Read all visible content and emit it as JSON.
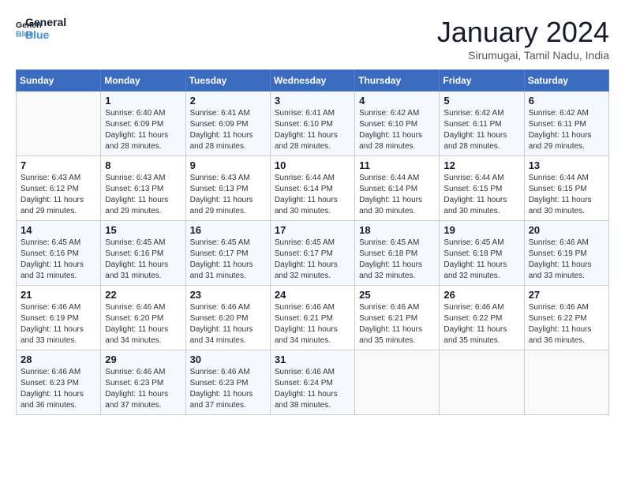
{
  "logo": {
    "text_general": "General",
    "text_blue": "Blue"
  },
  "title": "January 2024",
  "subtitle": "Sirumugai, Tamil Nadu, India",
  "header": {
    "days": [
      "Sunday",
      "Monday",
      "Tuesday",
      "Wednesday",
      "Thursday",
      "Friday",
      "Saturday"
    ]
  },
  "weeks": [
    {
      "cells": [
        {
          "day": "",
          "sunrise": "",
          "sunset": "",
          "daylight": ""
        },
        {
          "day": "1",
          "sunrise": "Sunrise: 6:40 AM",
          "sunset": "Sunset: 6:09 PM",
          "daylight": "Daylight: 11 hours and 28 minutes."
        },
        {
          "day": "2",
          "sunrise": "Sunrise: 6:41 AM",
          "sunset": "Sunset: 6:09 PM",
          "daylight": "Daylight: 11 hours and 28 minutes."
        },
        {
          "day": "3",
          "sunrise": "Sunrise: 6:41 AM",
          "sunset": "Sunset: 6:10 PM",
          "daylight": "Daylight: 11 hours and 28 minutes."
        },
        {
          "day": "4",
          "sunrise": "Sunrise: 6:42 AM",
          "sunset": "Sunset: 6:10 PM",
          "daylight": "Daylight: 11 hours and 28 minutes."
        },
        {
          "day": "5",
          "sunrise": "Sunrise: 6:42 AM",
          "sunset": "Sunset: 6:11 PM",
          "daylight": "Daylight: 11 hours and 28 minutes."
        },
        {
          "day": "6",
          "sunrise": "Sunrise: 6:42 AM",
          "sunset": "Sunset: 6:11 PM",
          "daylight": "Daylight: 11 hours and 29 minutes."
        }
      ]
    },
    {
      "cells": [
        {
          "day": "7",
          "sunrise": "Sunrise: 6:43 AM",
          "sunset": "Sunset: 6:12 PM",
          "daylight": "Daylight: 11 hours and 29 minutes."
        },
        {
          "day": "8",
          "sunrise": "Sunrise: 6:43 AM",
          "sunset": "Sunset: 6:13 PM",
          "daylight": "Daylight: 11 hours and 29 minutes."
        },
        {
          "day": "9",
          "sunrise": "Sunrise: 6:43 AM",
          "sunset": "Sunset: 6:13 PM",
          "daylight": "Daylight: 11 hours and 29 minutes."
        },
        {
          "day": "10",
          "sunrise": "Sunrise: 6:44 AM",
          "sunset": "Sunset: 6:14 PM",
          "daylight": "Daylight: 11 hours and 30 minutes."
        },
        {
          "day": "11",
          "sunrise": "Sunrise: 6:44 AM",
          "sunset": "Sunset: 6:14 PM",
          "daylight": "Daylight: 11 hours and 30 minutes."
        },
        {
          "day": "12",
          "sunrise": "Sunrise: 6:44 AM",
          "sunset": "Sunset: 6:15 PM",
          "daylight": "Daylight: 11 hours and 30 minutes."
        },
        {
          "day": "13",
          "sunrise": "Sunrise: 6:44 AM",
          "sunset": "Sunset: 6:15 PM",
          "daylight": "Daylight: 11 hours and 30 minutes."
        }
      ]
    },
    {
      "cells": [
        {
          "day": "14",
          "sunrise": "Sunrise: 6:45 AM",
          "sunset": "Sunset: 6:16 PM",
          "daylight": "Daylight: 11 hours and 31 minutes."
        },
        {
          "day": "15",
          "sunrise": "Sunrise: 6:45 AM",
          "sunset": "Sunset: 6:16 PM",
          "daylight": "Daylight: 11 hours and 31 minutes."
        },
        {
          "day": "16",
          "sunrise": "Sunrise: 6:45 AM",
          "sunset": "Sunset: 6:17 PM",
          "daylight": "Daylight: 11 hours and 31 minutes."
        },
        {
          "day": "17",
          "sunrise": "Sunrise: 6:45 AM",
          "sunset": "Sunset: 6:17 PM",
          "daylight": "Daylight: 11 hours and 32 minutes."
        },
        {
          "day": "18",
          "sunrise": "Sunrise: 6:45 AM",
          "sunset": "Sunset: 6:18 PM",
          "daylight": "Daylight: 11 hours and 32 minutes."
        },
        {
          "day": "19",
          "sunrise": "Sunrise: 6:45 AM",
          "sunset": "Sunset: 6:18 PM",
          "daylight": "Daylight: 11 hours and 32 minutes."
        },
        {
          "day": "20",
          "sunrise": "Sunrise: 6:46 AM",
          "sunset": "Sunset: 6:19 PM",
          "daylight": "Daylight: 11 hours and 33 minutes."
        }
      ]
    },
    {
      "cells": [
        {
          "day": "21",
          "sunrise": "Sunrise: 6:46 AM",
          "sunset": "Sunset: 6:19 PM",
          "daylight": "Daylight: 11 hours and 33 minutes."
        },
        {
          "day": "22",
          "sunrise": "Sunrise: 6:46 AM",
          "sunset": "Sunset: 6:20 PM",
          "daylight": "Daylight: 11 hours and 34 minutes."
        },
        {
          "day": "23",
          "sunrise": "Sunrise: 6:46 AM",
          "sunset": "Sunset: 6:20 PM",
          "daylight": "Daylight: 11 hours and 34 minutes."
        },
        {
          "day": "24",
          "sunrise": "Sunrise: 6:46 AM",
          "sunset": "Sunset: 6:21 PM",
          "daylight": "Daylight: 11 hours and 34 minutes."
        },
        {
          "day": "25",
          "sunrise": "Sunrise: 6:46 AM",
          "sunset": "Sunset: 6:21 PM",
          "daylight": "Daylight: 11 hours and 35 minutes."
        },
        {
          "day": "26",
          "sunrise": "Sunrise: 6:46 AM",
          "sunset": "Sunset: 6:22 PM",
          "daylight": "Daylight: 11 hours and 35 minutes."
        },
        {
          "day": "27",
          "sunrise": "Sunrise: 6:46 AM",
          "sunset": "Sunset: 6:22 PM",
          "daylight": "Daylight: 11 hours and 36 minutes."
        }
      ]
    },
    {
      "cells": [
        {
          "day": "28",
          "sunrise": "Sunrise: 6:46 AM",
          "sunset": "Sunset: 6:23 PM",
          "daylight": "Daylight: 11 hours and 36 minutes."
        },
        {
          "day": "29",
          "sunrise": "Sunrise: 6:46 AM",
          "sunset": "Sunset: 6:23 PM",
          "daylight": "Daylight: 11 hours and 37 minutes."
        },
        {
          "day": "30",
          "sunrise": "Sunrise: 6:46 AM",
          "sunset": "Sunset: 6:23 PM",
          "daylight": "Daylight: 11 hours and 37 minutes."
        },
        {
          "day": "31",
          "sunrise": "Sunrise: 6:46 AM",
          "sunset": "Sunset: 6:24 PM",
          "daylight": "Daylight: 11 hours and 38 minutes."
        },
        {
          "day": "",
          "sunrise": "",
          "sunset": "",
          "daylight": ""
        },
        {
          "day": "",
          "sunrise": "",
          "sunset": "",
          "daylight": ""
        },
        {
          "day": "",
          "sunrise": "",
          "sunset": "",
          "daylight": ""
        }
      ]
    }
  ]
}
